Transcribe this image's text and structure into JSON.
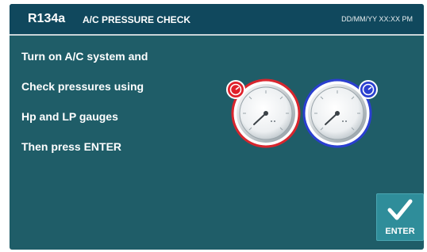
{
  "header": {
    "refrigerant": "R134a",
    "title": "A/C PRESSURE CHECK",
    "datetime": "DD/MM/YY XX:XX PM"
  },
  "instructions": [
    "Turn on A/C system and",
    "Check pressures using",
    "Hp and LP gauges",
    "Then press ENTER"
  ],
  "gauges": {
    "high_pressure": {
      "badge_icon": "hp-badge-icon",
      "color": "#e0202a"
    },
    "low_pressure": {
      "badge_icon": "lp-badge-icon",
      "color": "#2a3fd0"
    }
  },
  "enter_button": {
    "label": "ENTER",
    "icon": "check-icon"
  },
  "colors": {
    "background": "#1f5d68",
    "header": "#10485d",
    "button": "#2f8d9a"
  }
}
